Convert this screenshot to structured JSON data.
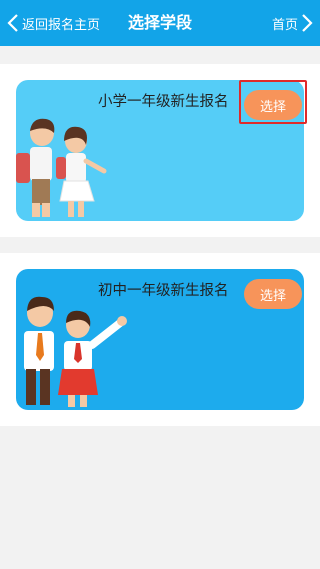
{
  "header": {
    "back_label": "返回报名主页",
    "title": "选择学段",
    "home_label": "首页"
  },
  "cards": [
    {
      "title": "小学一年级新生报名",
      "button_label": "选择"
    },
    {
      "title": "初中一年级新生报名",
      "button_label": "选择"
    }
  ],
  "colors": {
    "header": "#12a4e8",
    "card1_bg": "#55cdf7",
    "card2_bg": "#1dabed",
    "button": "#f7945a",
    "highlight": "#e02a2a"
  }
}
